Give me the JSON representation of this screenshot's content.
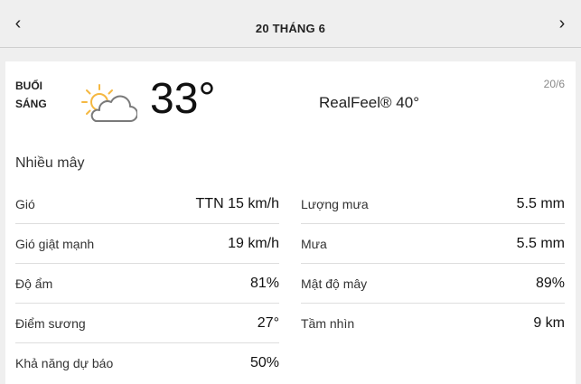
{
  "header": {
    "date_title": "20 THÁNG 6",
    "prev_icon": "chevron-left-icon",
    "next_icon": "chevron-right-icon"
  },
  "card": {
    "period_line1": "BUỔI",
    "period_line2": "SÁNG",
    "weather_icon": "partly-cloudy-icon",
    "temperature": "33°",
    "realfeel": "RealFeel® 40°",
    "small_date": "20/6",
    "condition": "Nhiều mây"
  },
  "details_left": [
    {
      "label": "Gió",
      "value": "TTN 15 km/h"
    },
    {
      "label": "Gió giật mạnh",
      "value": "19 km/h"
    },
    {
      "label": "Độ ẩm",
      "value": "81%"
    },
    {
      "label": "Điểm sương",
      "value": "27°"
    },
    {
      "label": "Khả năng dự báo",
      "value": "50%"
    }
  ],
  "details_right": [
    {
      "label": "Lượng mưa",
      "value": "5.5 mm"
    },
    {
      "label": "Mưa",
      "value": "5.5 mm"
    },
    {
      "label": "Mật độ mây",
      "value": "89%"
    },
    {
      "label": "Tầm nhìn",
      "value": "9 km"
    }
  ],
  "colors": {
    "sun": "#f5b841",
    "cloud_stroke": "#7a7a7a",
    "background": "#efefef"
  }
}
